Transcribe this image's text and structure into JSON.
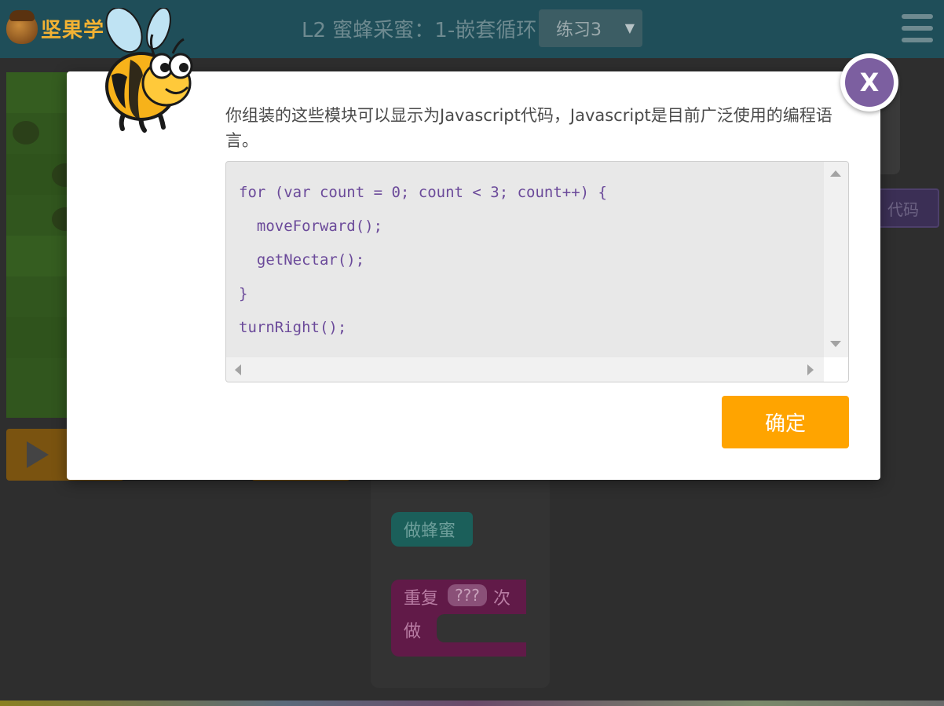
{
  "header": {
    "logo_text": "坚果学",
    "title": "L2 蜜蜂采蜜：1-嵌套循环",
    "level_select": "练习3",
    "caret": "▼"
  },
  "sidebar": {
    "show_code_label": "代码"
  },
  "toolbox": {
    "nectar_block": "做蜂蜜",
    "repeat_label": "重复",
    "repeat_field": "???",
    "repeat_times": "次",
    "do_label": "做"
  },
  "dialog": {
    "message": "你组装的这些模块可以显示为Javascript代码，Javascript是目前广泛使用的编程语言。",
    "code_lines": [
      "for (var count = 0; count < 3; count++) {",
      "  moveForward();",
      "  getNectar();",
      "}",
      "turnRight();"
    ],
    "ok_label": "确定",
    "close_label": "X"
  },
  "colors": {
    "accent_orange": "#ffa400",
    "close_purple": "#7c5fa0",
    "code_text": "#6b4a9a"
  }
}
